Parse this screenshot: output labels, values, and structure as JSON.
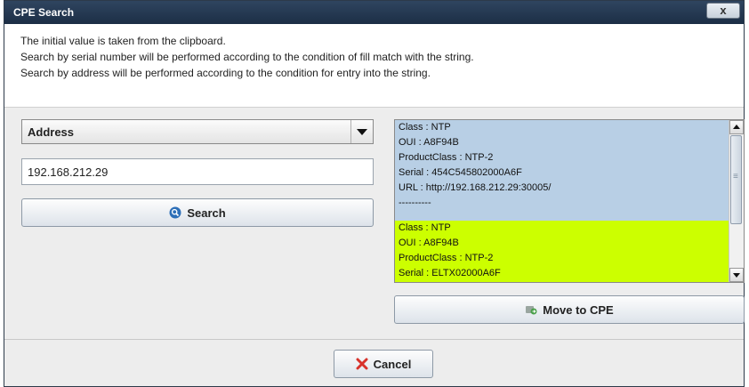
{
  "window": {
    "title": "CPE Search",
    "close_label": "x"
  },
  "info": {
    "lines": [
      "The initial value is taken from the clipboard.",
      "Search by serial number will be performed according to the condition of fill match with the string.",
      "Search by address will be performed according to the condition for entry into the string."
    ]
  },
  "search": {
    "mode_value": "Address",
    "input_value": "192.168.212.29",
    "button_label": "Search"
  },
  "results": [
    {
      "lines": [
        "Class : NTP",
        "OUI : A8F94B",
        "ProductClass : NTP-2",
        "Serial : 454C545802000A6F",
        "URL : http://192.168.212.29:30005/"
      ],
      "separator": "----------",
      "color": "#b8cfe5"
    },
    {
      "lines": [
        "Class : NTP",
        "OUI : A8F94B",
        "ProductClass : NTP-2",
        "Serial : ELTX02000A6F"
      ],
      "color": "#ccff00"
    }
  ],
  "actions": {
    "move_label": "Move to CPE",
    "cancel_label": "Cancel"
  },
  "icons": {
    "search": "search-icon",
    "move": "move-to-cpe-icon",
    "cancel": "cancel-x-icon"
  }
}
